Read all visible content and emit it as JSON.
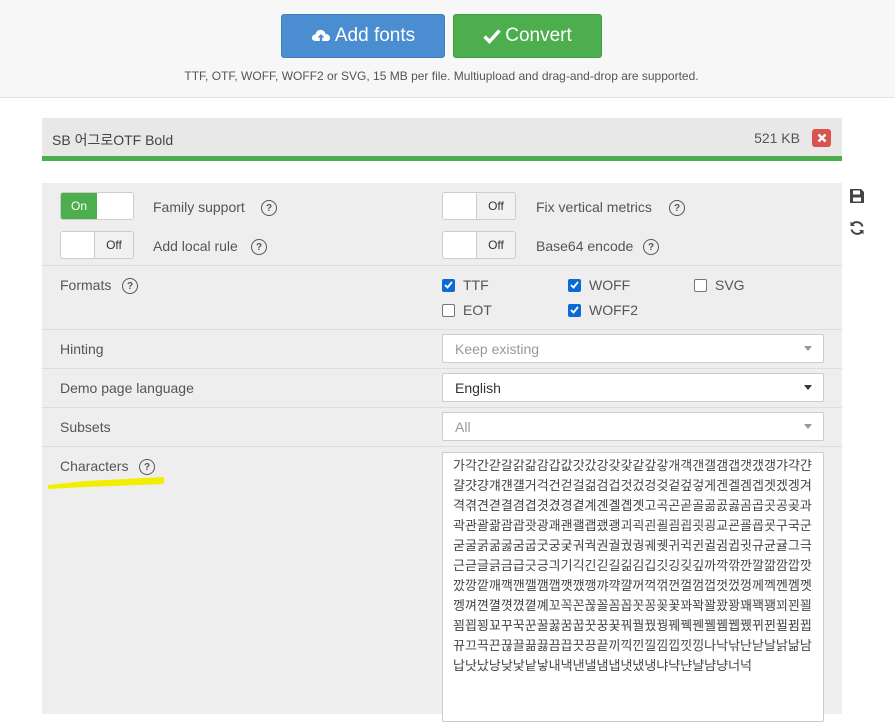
{
  "header": {
    "add_fonts_label": "Add fonts",
    "convert_label": "Convert",
    "hint": "TTF, OTF, WOFF, WOFF2 or SVG, 15 MB per file. Multiupload and drag-and-drop are supported."
  },
  "file": {
    "name": "SB 어그로OTF Bold",
    "size": "521 KB",
    "progress_percent": 100
  },
  "options": {
    "family_support": {
      "label": "Family support",
      "state": "On",
      "help": "?"
    },
    "fix_vertical_metrics": {
      "label": "Fix vertical metrics",
      "state": "Off",
      "help": "?"
    },
    "add_local_rule": {
      "label": "Add local rule",
      "state": "Off",
      "help": "?"
    },
    "base64_encode": {
      "label": "Base64 encode",
      "state": "Off",
      "help": "?"
    },
    "formats": {
      "label": "Formats",
      "help": "?",
      "items": [
        {
          "name": "TTF",
          "checked": true
        },
        {
          "name": "WOFF",
          "checked": true
        },
        {
          "name": "SVG",
          "checked": false
        },
        {
          "name": "EOT",
          "checked": false
        },
        {
          "name": "WOFF2",
          "checked": true
        }
      ]
    },
    "hinting": {
      "label": "Hinting",
      "value": "Keep existing"
    },
    "demo_page_language": {
      "label": "Demo page language",
      "value": "English"
    },
    "subsets": {
      "label": "Subsets",
      "value": "All"
    },
    "characters": {
      "label": "Characters",
      "help": "?",
      "value": "가각간갇갈갉갊감갑값갓갔강갖갗같갚갛개객갠갤갬갭갯갰갱갸갹갼걀걋걍걔걘걜거걱건걷걸걺검겁것겄겅겆겉겊겋게겐겔겜겝겟겠겡겨격겪견겯결겸겹겻겼경곁계곈곌곕곗고곡곤곧골곪곬곯곰곱곳공곶과곽관괄괆괌괍괏광괘괜괠괩괬괭괴괵괸괼굄굅굇굉교굔굘굡굣구국군굳굴굵굶굻굼굽굿궁궂궈궉권궐궜궝궤궷귀귁귄귈귐귑귓규균귤그극근귿글긁금급긋긍긔기긱긴긷길긺김깁깃깅깆깊까깍깎깐깔깖깜깝깟깠깡깥깨깩깬깰깸깹깻깼깽꺄꺅꺌꺼꺽꺾껀껄껌껍껏껐껑께껙껜껨껫껭껴껸껼꼇꼈꼍꼐꼬꼭꼰꼲꼴꼼꼽꼿꽁꽂꽃꽈꽉꽐꽜꽝꽤꽥꽹꾀꾄꾈꾐꾑꾕꾜꾸꾹꾼꿀꿇꿈꿉꿋꿍꿎꿔꿜꿨꿩꿰꿱꿴꿸뀀뀁뀄뀌뀐뀔뀜뀝뀨끄끅끈끊끌끎끓끔끕끗끙끝끼끽낀낄낌낍낏낑나낙낚난낟날낡낢남납낫났낭낮낯낱낳내낵낸낼냄냅냇냈냉냐냑냔냘냠냥너넉"
    }
  },
  "side_tools": [
    "save-icon",
    "refresh-icon"
  ],
  "colors": {
    "add_button": "#4a8dd0",
    "convert_button": "#4cae4c",
    "remove_button": "#d9534f",
    "highlight": "#f2ee00"
  }
}
